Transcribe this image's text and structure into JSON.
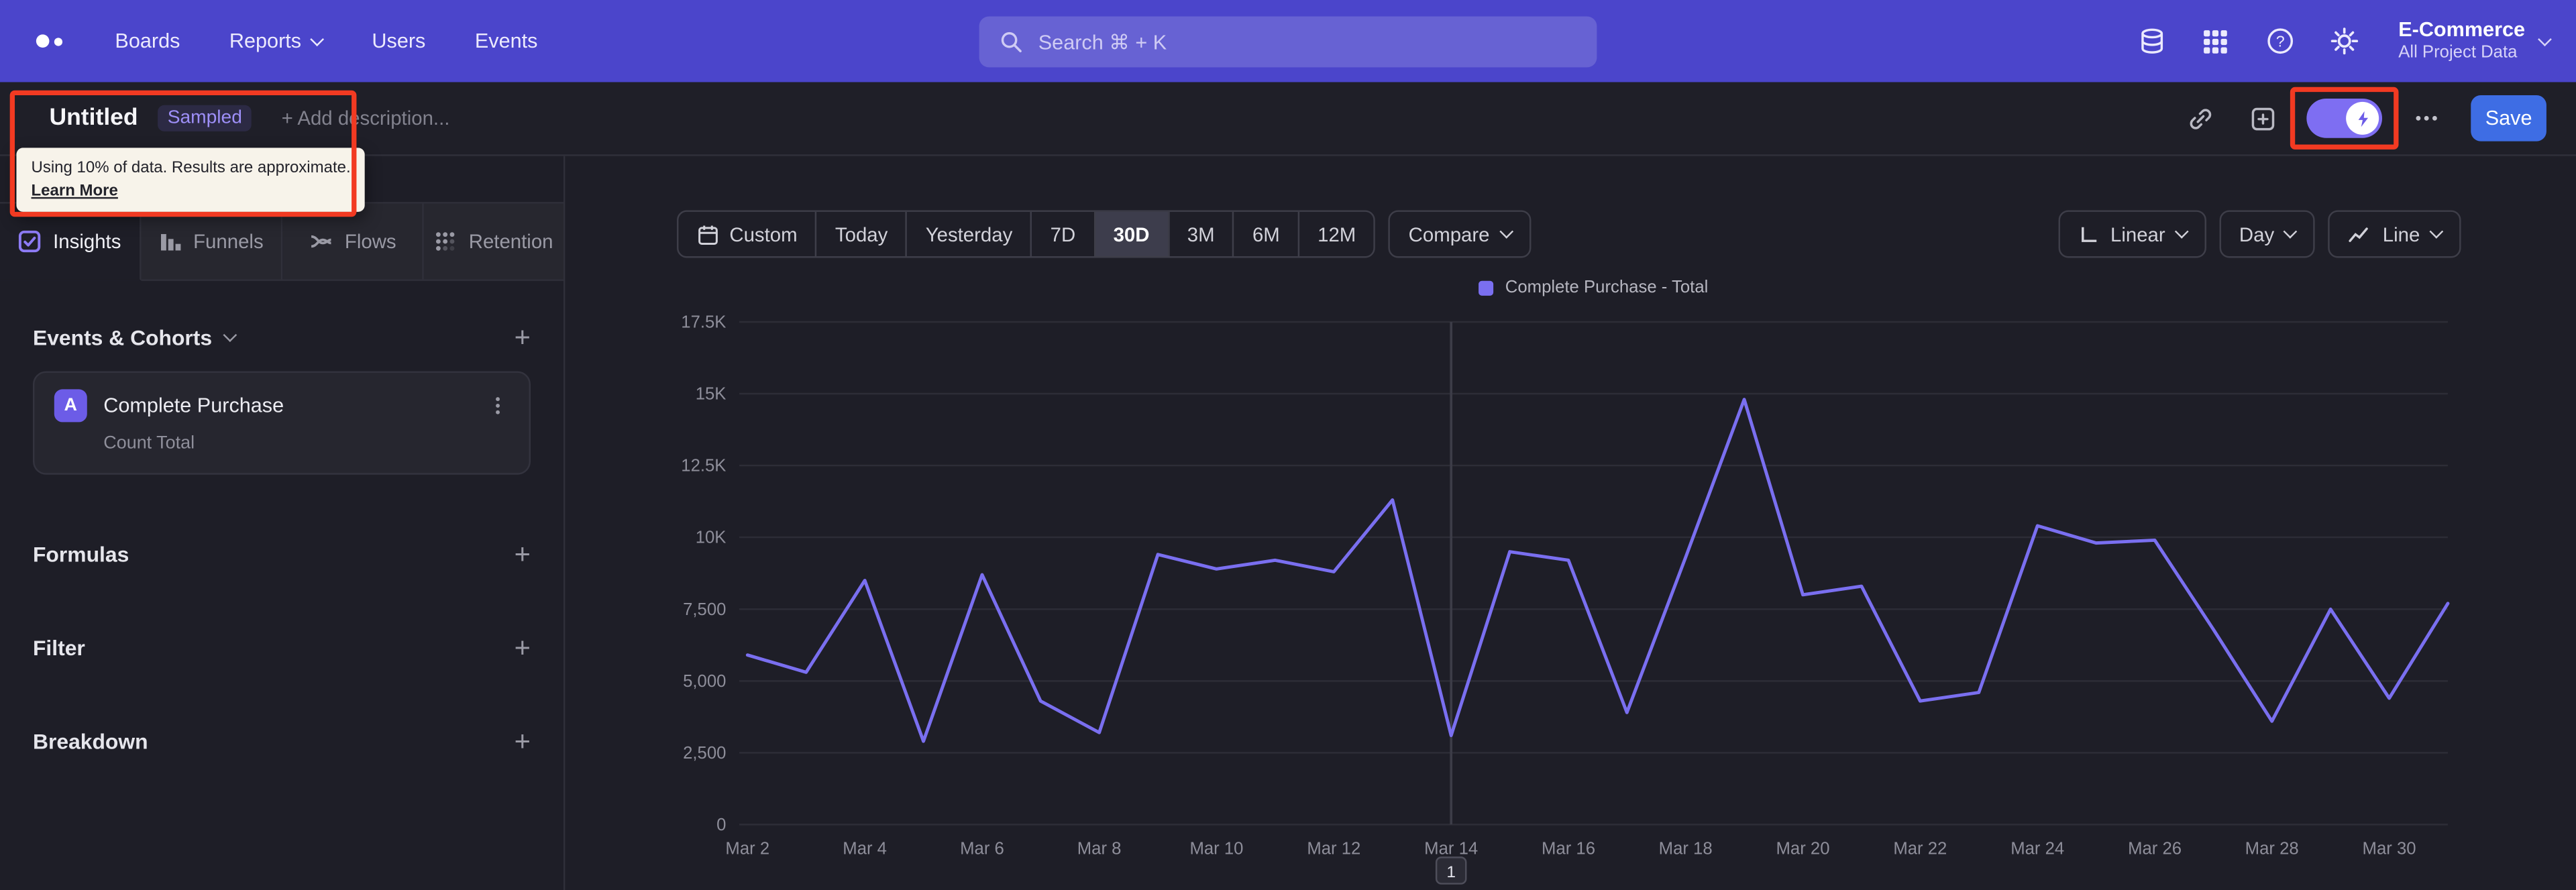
{
  "nav": {
    "menu": [
      "Boards",
      "Reports",
      "Users",
      "Events"
    ],
    "search_placeholder": "Search  ⌘ + K",
    "project": {
      "name": "E-Commerce",
      "scope": "All Project Data"
    }
  },
  "header": {
    "title": "Untitled",
    "tag": "Sampled",
    "add_description": "+ Add description...",
    "tooltip": {
      "line1": "Using 10% of data. Results are approximate.",
      "link": "Learn More"
    },
    "save_label": "Save"
  },
  "sidebar": {
    "tabs": [
      "Insights",
      "Funnels",
      "Flows",
      "Retention"
    ],
    "sections": {
      "events_title": "Events & Cohorts",
      "formulas": "Formulas",
      "filter": "Filter",
      "breakdown": "Breakdown"
    },
    "event": {
      "badge": "A",
      "name": "Complete Purchase",
      "metric": "Count Total"
    }
  },
  "controls": {
    "ranges": [
      "Custom",
      "Today",
      "Yesterday",
      "7D",
      "30D",
      "3M",
      "6M",
      "12M"
    ],
    "selected_range": "30D",
    "compare": "Compare",
    "scale": "Linear",
    "interval": "Day",
    "chart_type": "Line"
  },
  "chart_data": {
    "type": "line",
    "title": "",
    "legend": [
      {
        "name": "Complete Purchase - Total",
        "color": "#7a6ff0"
      }
    ],
    "x": [
      "Mar 2",
      "Mar 3",
      "Mar 4",
      "Mar 5",
      "Mar 6",
      "Mar 7",
      "Mar 8",
      "Mar 9",
      "Mar 10",
      "Mar 11",
      "Mar 12",
      "Mar 13",
      "Mar 14",
      "Mar 15",
      "Mar 16",
      "Mar 17",
      "Mar 18",
      "Mar 19",
      "Mar 20",
      "Mar 21",
      "Mar 22",
      "Mar 23",
      "Mar 24",
      "Mar 25",
      "Mar 26",
      "Mar 27",
      "Mar 28",
      "Mar 29",
      "Mar 30",
      "Mar 31"
    ],
    "values": [
      5900,
      5300,
      8500,
      2900,
      8700,
      4300,
      3200,
      9400,
      8900,
      9200,
      8800,
      11300,
      3100,
      9500,
      9200,
      3900,
      9300,
      14800,
      8000,
      8300,
      4300,
      4600,
      10400,
      9800,
      9900,
      6800,
      3600,
      7500,
      4400,
      7700
    ],
    "ylim": [
      0,
      17500
    ],
    "yticks": [
      0,
      2500,
      5000,
      7500,
      10000,
      12500,
      15000,
      17500
    ],
    "ytick_labels": [
      "0",
      "2,500",
      "5,000",
      "7,500",
      "10K",
      "12.5K",
      "15K",
      "17.5K"
    ],
    "xtick_every": 2,
    "grid": true,
    "legend_position": "top-center",
    "annotation": {
      "label": "1",
      "x": "Mar 14"
    }
  }
}
